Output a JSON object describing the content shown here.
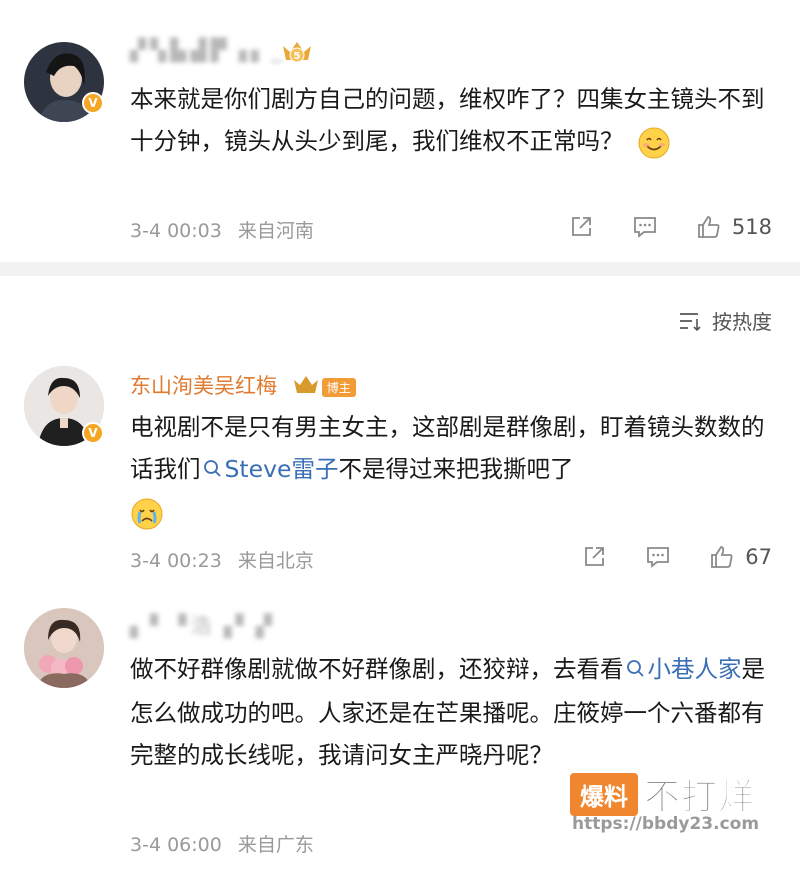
{
  "comments": [
    {
      "username": "▞▚▙▟▛▗▖_",
      "badge_level": "5",
      "text": "本来就是你们剧方自己的问题，维权咋了？四集女主镜头不到十分钟，镜头从头少到尾，我们维权不正常吗？",
      "time": "3-4 00:03",
      "location": "来自河南",
      "likes": "518"
    },
    {
      "username": "东山洵美吴红梅",
      "tag": "博主",
      "text_before": "电视剧不是只有男主女主，这部剧是群像剧，盯着镜头数数的话我们",
      "link_text": "Steve雷子",
      "text_after": "不是得过来把我撕吧了",
      "time": "3-4 00:23",
      "location": "来自北京",
      "likes": "67"
    },
    {
      "username": "▖▘▝浩▗▘▞",
      "text_before": "做不好群像剧就做不好群像剧，还狡辩，去看看",
      "link_text": "小巷人家",
      "text_after": "是怎么做成功的吧。人家还是在芒果播呢。庄筱婷一个六番都有完整的成长线呢，我请问女主严晓丹呢？",
      "time": "3-4 06:00",
      "location": "来自广东"
    }
  ],
  "sort_label": "按热度",
  "watermark": {
    "box_text": "爆料",
    "text": "不打烊",
    "url": "https://bbdy23.com"
  },
  "icons": [
    "share-icon",
    "comment-icon",
    "like-icon",
    "sort-icon",
    "verified-icon",
    "crown-icon",
    "smile-emoji",
    "crying-emoji",
    "search-link-icon"
  ],
  "colors": {
    "username": "#e07a2e",
    "link": "#3a6fb5",
    "meta": "#9a9a9a",
    "badge": "#f5a623"
  }
}
